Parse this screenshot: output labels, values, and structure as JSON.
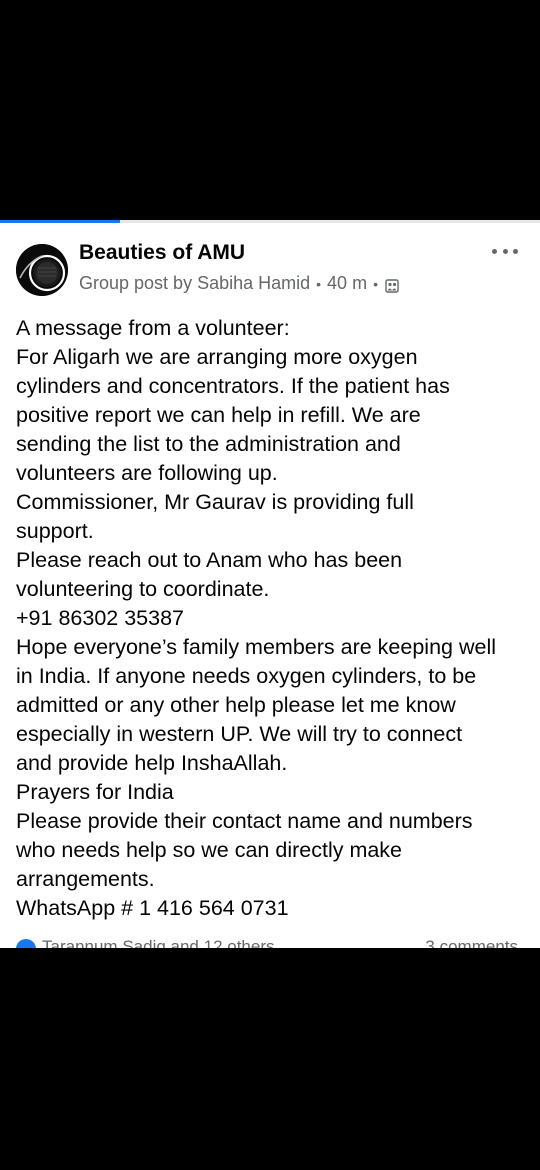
{
  "post": {
    "group_name": "Beauties of AMU",
    "meta_prefix": "Group post by",
    "author": "Sabiha Hamid",
    "time": "40 m",
    "separator": "•",
    "lines": [
      "A message from a volunteer:",
      "For Aligarh we are arranging more oxygen",
      "cylinders and concentrators. If the patient has",
      "positive report we can help in refill. We are",
      "sending the list to the administration and",
      "volunteers are following up.",
      "Commissioner, Mr Gaurav is providing full",
      "support.",
      "Please reach out to Anam who has been",
      "volunteering to coordinate.",
      "+91 86302 35387",
      "Hope everyone’s family members are keeping well",
      "in India. If anyone needs oxygen cylinders, to be",
      "admitted or any other help please let me know",
      "especially in western UP. We will try to connect",
      "and provide help InshaAllah.",
      "Prayers for India",
      "Please provide their contact name and numbers",
      "who needs help so we can directly make",
      "arrangements.",
      "WhatsApp # 1 416 564 0731"
    ]
  },
  "footer": {
    "reaction_text": "Tarannum Sadiq and 12 others",
    "comments": "3 comments"
  },
  "icons": {
    "more": "more-options-icon",
    "audience": "group-audience-icon",
    "reaction": "like-reaction-icon"
  },
  "colors": {
    "accent": "#1877f2",
    "text": "#050505",
    "secondary": "#65676b"
  }
}
